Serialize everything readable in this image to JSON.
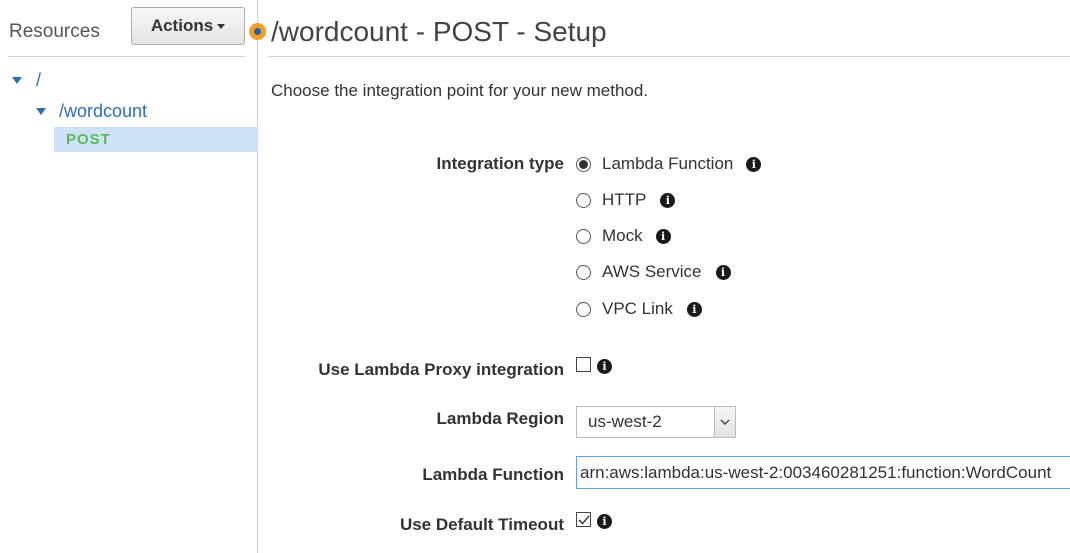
{
  "sidebar": {
    "title": "Resources",
    "actions_label": "Actions",
    "tree": [
      {
        "label": "/"
      },
      {
        "label": "/wordcount"
      },
      {
        "label": "POST"
      }
    ]
  },
  "main": {
    "title": "/wordcount - POST - Setup",
    "intro": "Choose the integration point for your new method.",
    "integration_type": {
      "label": "Integration type",
      "options": [
        {
          "label": "Lambda Function",
          "selected": true
        },
        {
          "label": "HTTP",
          "selected": false
        },
        {
          "label": "Mock",
          "selected": false
        },
        {
          "label": "AWS Service",
          "selected": false
        },
        {
          "label": "VPC Link",
          "selected": false
        }
      ]
    },
    "proxy": {
      "label": "Use Lambda Proxy integration",
      "checked": false
    },
    "region": {
      "label": "Lambda Region",
      "value": "us-west-2"
    },
    "function": {
      "label": "Lambda Function",
      "value": "arn:aws:lambda:us-west-2:003460281251:function:WordCount"
    },
    "timeout": {
      "label": "Use Default Timeout",
      "checked": true
    }
  },
  "colors": {
    "link_blue": "#2f6fb5",
    "method_green": "#5cb85c",
    "selected_row": "#cfe3f8",
    "status_dot": "#f0a02a"
  }
}
